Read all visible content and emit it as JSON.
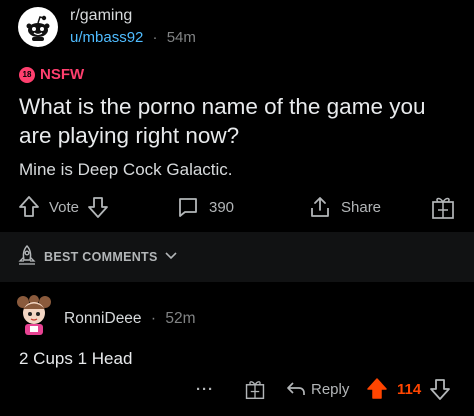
{
  "post": {
    "subreddit": "r/gaming",
    "author": "u/mbass92",
    "separator": "·",
    "age": "54m",
    "nsfw_label": "NSFW",
    "nsfw_icon_text": "18",
    "title": "What is the porno name of the game you are playing right now?",
    "body": "Mine is Deep Cock Galactic.",
    "vote_label": "Vote",
    "comment_count": "390",
    "share_label": "Share",
    "icons": [
      "reddit-snoo-icon",
      "nsfw-icon",
      "upvote-icon",
      "downvote-icon",
      "comment-icon",
      "share-icon",
      "award-icon"
    ]
  },
  "sort": {
    "label": "BEST COMMENTS",
    "icons": [
      "rocket-icon",
      "chevron-down-icon"
    ]
  },
  "comment": {
    "author": "RonniDeee",
    "separator": "·",
    "age": "52m",
    "body": "2 Cups 1 Head",
    "more_label": "···",
    "reply_label": "Reply",
    "score": "114",
    "icons": [
      "more-icon",
      "award-icon",
      "reply-icon",
      "upvote-icon",
      "downvote-icon"
    ]
  },
  "colors": {
    "background": "#000000",
    "band": "#111213",
    "text": "#d7dadc",
    "muted": "#818384",
    "link": "#4fbcff",
    "nsfw": "#ff3f6e",
    "upvote": "#ff4500"
  }
}
